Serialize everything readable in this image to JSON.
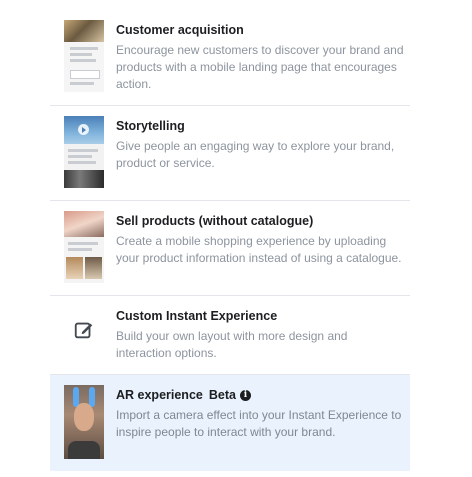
{
  "options": [
    {
      "title": "Customer acquisition",
      "description": "Encourage new customers to discover your brand and products with a mobile landing page that encourages action.",
      "thumbnail_icon": "landing-page-thumbnail"
    },
    {
      "title": "Storytelling",
      "description": "Give people an engaging way to explore your brand, product or service.",
      "thumbnail_icon": "video-story-thumbnail"
    },
    {
      "title": "Sell products (without catalogue)",
      "description": "Create a mobile shopping experience by uploading your product information instead of using a catalogue.",
      "thumbnail_icon": "shopping-thumbnail"
    },
    {
      "title": "Custom Instant Experience",
      "description": "Build your own layout with more design and interaction options.",
      "thumbnail_icon": "edit-icon"
    },
    {
      "title": "AR experience",
      "badge": "Beta",
      "description": "Import a camera effect into your Instant Experience to inspire people to interact with your brand.",
      "thumbnail_icon": "ar-face-thumbnail",
      "selected": true
    }
  ],
  "colors": {
    "selected_background": "#eaf3fd",
    "divider": "#e4e6eb",
    "description_text": "#8d949e",
    "title_text": "#1c1e21"
  }
}
